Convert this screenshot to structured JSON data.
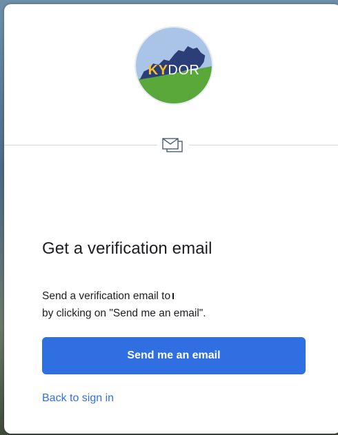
{
  "logo": {
    "text_ky": "KY",
    "text_dor": "DOR",
    "colors": {
      "sky": "#a9c4e6",
      "state": "#2c3e78",
      "grass": "#5aa83a",
      "ky_text": "#f2c230"
    }
  },
  "factor": {
    "icon": "mail-icon"
  },
  "title": "Get a verification email",
  "description": {
    "line1": "Send a verification email to",
    "line2": "by clicking on \"Send me an email\"."
  },
  "buttons": {
    "send_label": "Send me an email",
    "primary_color": "#2f6fe1"
  },
  "links": {
    "back_label": "Back to sign in"
  }
}
